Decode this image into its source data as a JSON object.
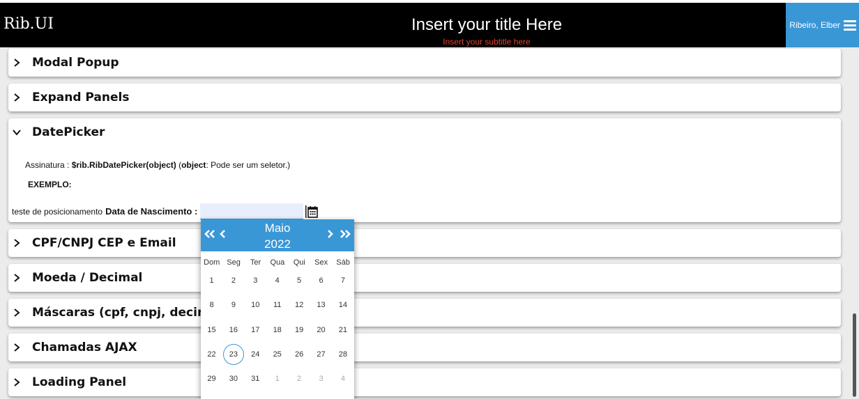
{
  "header": {
    "brand": "Rib.UI",
    "title": "Insert your title Here",
    "subtitle": "Insert your subtitle here",
    "user": "Ribeiro, Elber"
  },
  "panels": [
    {
      "label": "Modal Popup",
      "expanded": false
    },
    {
      "label": "Expand Panels",
      "expanded": false
    },
    {
      "label": "DatePicker",
      "expanded": true
    },
    {
      "label": "CPF/CNPJ CEP e Email",
      "expanded": false
    },
    {
      "label": "Moeda / Decimal",
      "expanded": false
    },
    {
      "label": "Máscaras (cpf, cnpj, decim",
      "expanded": false
    },
    {
      "label": "Chamadas AJAX",
      "expanded": false
    },
    {
      "label": "Loading Panel",
      "expanded": false
    }
  ],
  "datepicker": {
    "signature_prefix": "Assinatura : ",
    "signature_code": "$rib.RibDatePicker(object)",
    "signature_open": " (",
    "signature_param": "object",
    "signature_desc": ": Pode ser um seletor.)",
    "example_label": "EXEMPLO:",
    "positioning_label": "teste de posicionamento",
    "field_label": "Data de Nascimento :",
    "field_value": ""
  },
  "calendar": {
    "month": "Maio",
    "year": "2022",
    "weekdays": [
      "Dom",
      "Seg",
      "Ter",
      "Qua",
      "Qui",
      "Sex",
      "Sáb"
    ],
    "weeks": [
      [
        "1",
        "2",
        "3",
        "4",
        "5",
        "6",
        "7"
      ],
      [
        "8",
        "9",
        "10",
        "11",
        "12",
        "13",
        "14"
      ],
      [
        "15",
        "16",
        "17",
        "18",
        "19",
        "20",
        "21"
      ],
      [
        "22",
        "23",
        "24",
        "25",
        "26",
        "27",
        "28"
      ],
      [
        "29",
        "30",
        "31",
        "1",
        "2",
        "3",
        "4"
      ]
    ],
    "today": "23",
    "accent": "#3a97d6"
  },
  "colors": {
    "header_bg": "#000000",
    "accent": "#3a97d6",
    "subtitle": "#e0452e",
    "page_bg": "#ececec"
  }
}
